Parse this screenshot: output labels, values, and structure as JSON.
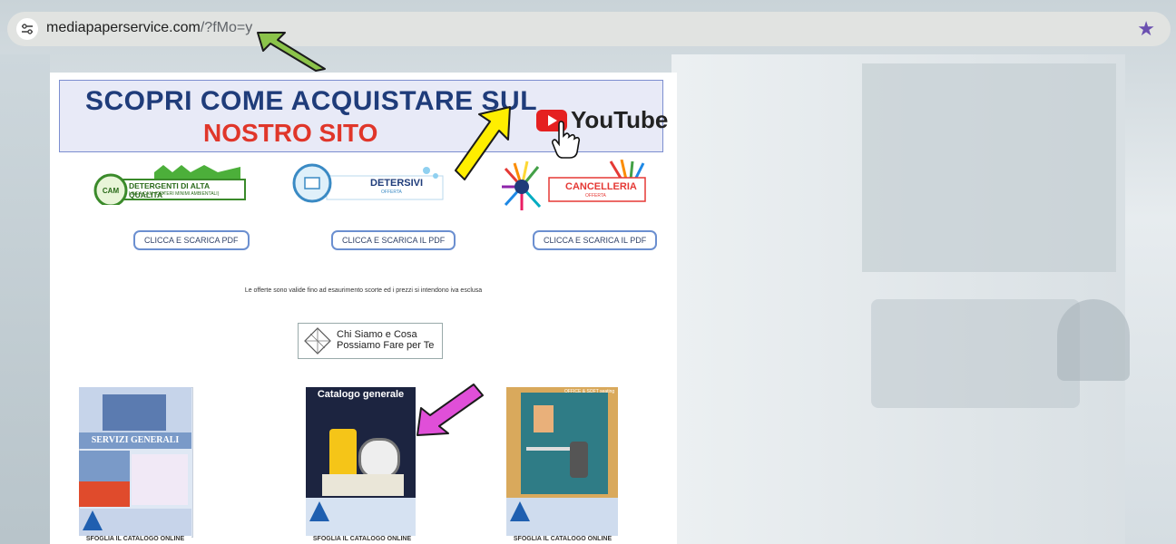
{
  "browser": {
    "url_host": "mediapaperservice.com",
    "url_path": "/?fMo=y"
  },
  "banner": {
    "line1": "SCOPRI COME ACQUISTARE SUL",
    "line2": "NOSTRO SITO",
    "youtube": "YouTube"
  },
  "logos": [
    {
      "title": "DETERGENTI DI ALTA QUALITA'",
      "subtitle": "LINEA CAM (CRITERI MINIMI AMBIENTALI)"
    },
    {
      "title": "DETERSIVI",
      "subtitle": "OFFERTA"
    },
    {
      "title": "CANCELLERIA",
      "subtitle": "OFFERTA"
    }
  ],
  "buttons": [
    "CLICCA E SCARICA PDF",
    "CLICCA E SCARICA IL PDF",
    "CLICCA E SCARICA IL PDF"
  ],
  "offers_text": "Le offerte sono valide fino ad esaurimento scorte ed i prezzi si intendono iva esclusa",
  "chi_siamo": "Chi Siamo e Cosa Possiamo Fare per Te",
  "catalogs": [
    {
      "title": "SERVIZI GENERALI",
      "caption": "SFOGLIA IL CATALOGO ONLINE"
    },
    {
      "title": "Catalogo generale",
      "caption": "SFOGLIA IL CATALOGO ONLINE"
    },
    {
      "title": "OFFICE & SOFT seating",
      "caption": "SFOGLIA IL CATALOGO ONLINE"
    }
  ],
  "colors": {
    "accent_star": "#6a4fb0",
    "banner_title": "#1f3c7a",
    "banner_red": "#e0362a",
    "arrow_green": "#8bc34a",
    "arrow_yellow": "#ffee00",
    "arrow_magenta": "#e04fd8"
  }
}
